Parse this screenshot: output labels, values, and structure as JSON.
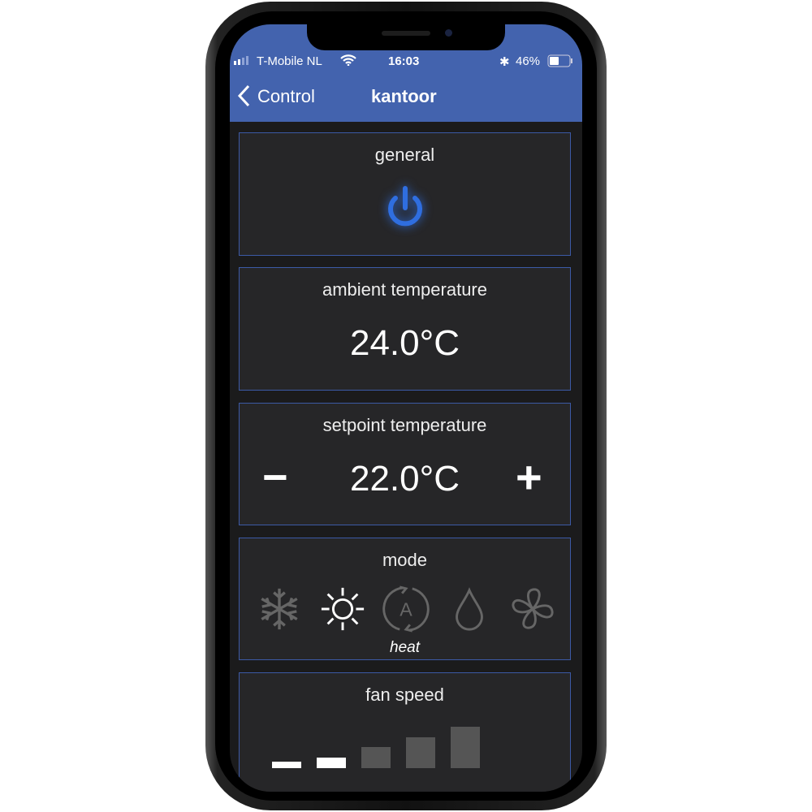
{
  "status": {
    "carrier": "T-Mobile NL",
    "time": "16:03",
    "battery": "46%",
    "battery_level": 0.46
  },
  "nav": {
    "back_label": "Control",
    "title": "kantoor"
  },
  "general": {
    "title": "general",
    "power_on": true
  },
  "ambient": {
    "title": "ambient temperature",
    "value": "24.0°C"
  },
  "setpoint": {
    "title": "setpoint temperature",
    "value": "22.0°C",
    "minus": "−",
    "plus": "+"
  },
  "mode": {
    "title": "mode",
    "options": [
      "cool",
      "heat",
      "auto",
      "dry",
      "fan"
    ],
    "selected": "heat",
    "selected_label": "heat"
  },
  "fan": {
    "title": "fan speed",
    "levels": 5,
    "selected_level": 2
  },
  "colors": {
    "accent": "#4363ae",
    "power": "#2f6ee0",
    "card_border": "#3c5aa6"
  }
}
